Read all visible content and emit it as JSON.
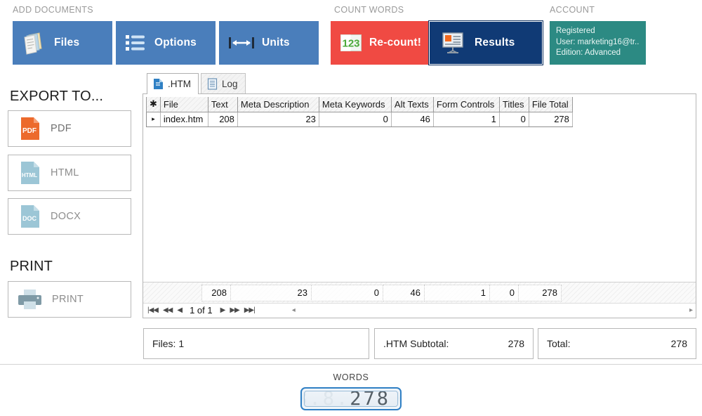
{
  "sections": {
    "add_documents": "ADD DOCUMENTS",
    "count_words": "COUNT WORDS",
    "account": "ACCOUNT",
    "export_to": "EXPORT TO...",
    "print": "PRINT",
    "words": "WORDS"
  },
  "ribbon": {
    "files": {
      "label": "Files",
      "icon": "documents-icon"
    },
    "options": {
      "label": "Options",
      "icon": "bullet-list-icon"
    },
    "units": {
      "label": "Units",
      "icon": "horizontal-arrow-icon"
    },
    "recount": {
      "label": "Re-count!",
      "icon": "123-icon"
    },
    "results": {
      "label": "Results",
      "icon": "presentation-board-icon",
      "selected": true
    }
  },
  "account": {
    "status": "Registered",
    "user": "User: marketing16@tr...",
    "edition": "Edition: Advanced"
  },
  "export": {
    "items": [
      {
        "label": "PDF",
        "icon": "pdf-file-icon",
        "enabled": true
      },
      {
        "label": "HTML",
        "icon": "html-file-icon",
        "enabled": false
      },
      {
        "label": "DOCX",
        "icon": "doc-file-icon",
        "enabled": false
      }
    ],
    "print": {
      "label": "PRINT",
      "icon": "printer-icon",
      "enabled": false
    }
  },
  "tabs": [
    {
      "label": ".HTM",
      "icon": "htm-file-icon",
      "active": true
    },
    {
      "label": "Log",
      "icon": "log-document-icon",
      "active": false
    }
  ],
  "grid": {
    "columns": [
      "File",
      "Text",
      "Meta Description",
      "Meta Keywords",
      "Alt Texts",
      "Form Controls",
      "Titles",
      "File Total"
    ],
    "rows": [
      {
        "File": "index.htm",
        "Text": "208",
        "Meta Description": "23",
        "Meta Keywords": "0",
        "Alt Texts": "46",
        "Form Controls": "1",
        "Titles": "0",
        "File Total": "278"
      }
    ],
    "aggregates": [
      "208",
      "23",
      "0",
      "46",
      "1",
      "0",
      "278"
    ],
    "pager": {
      "position": "1 of 1"
    }
  },
  "summary": {
    "files_label": "Files: 1",
    "subtotal_label": ".HTM Subtotal:",
    "subtotal_value": "278",
    "total_label": "Total:",
    "total_value": "278"
  },
  "counter": {
    "ghost": "8.8.8.8.8.",
    "value": "278"
  },
  "colors": {
    "ribbon_blue": "#4a7ebb",
    "recount_red": "#f04a43",
    "results_navy": "#103a75",
    "account_teal": "#2c8a83",
    "pdf_orange": "#e8622c",
    "muted_blue": "#9cc6d6",
    "lcd_border": "#2f7fc4"
  }
}
